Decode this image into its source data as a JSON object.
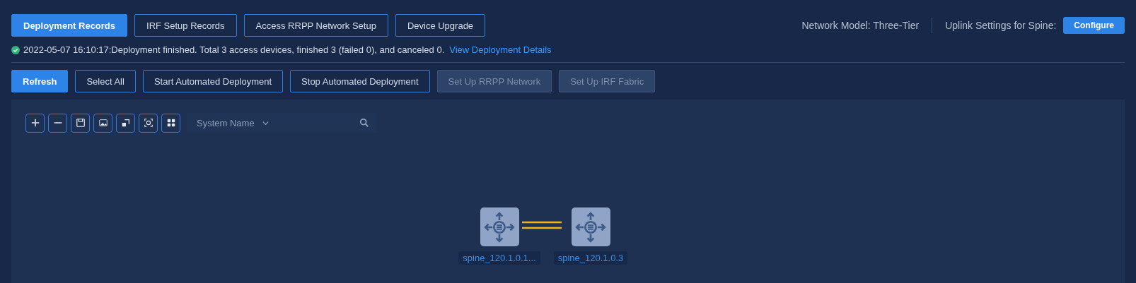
{
  "tabs": [
    {
      "label": "Deployment Records",
      "selected": true
    },
    {
      "label": "IRF Setup Records",
      "selected": false
    },
    {
      "label": "Access RRPP Network Setup",
      "selected": false
    },
    {
      "label": "Device Upgrade",
      "selected": false
    }
  ],
  "network_model": "Network Model: Three-Tier",
  "uplink": {
    "label": "Uplink Settings for Spine:",
    "button": "Configure"
  },
  "status": {
    "message": "2022-05-07 16:10:17:Deployment finished. Total 3 access devices, finished 3 (failed 0), and canceled 0.",
    "link": "View Deployment Details"
  },
  "actions": [
    {
      "label": "Refresh",
      "kind": "primary",
      "disabled": false
    },
    {
      "label": "Select All",
      "kind": "outline",
      "disabled": false
    },
    {
      "label": "Start Automated Deployment",
      "kind": "outline",
      "disabled": false
    },
    {
      "label": "Stop Automated Deployment",
      "kind": "outline",
      "disabled": false
    },
    {
      "label": "Set Up RRPP Network",
      "kind": "outline",
      "disabled": true
    },
    {
      "label": "Set Up IRF Fabric",
      "kind": "outline",
      "disabled": true
    }
  ],
  "search": {
    "filter": "System Name"
  },
  "topology": {
    "nodes": [
      {
        "label": "spine_120.1.0.1..."
      },
      {
        "label": "spine_120.1.0.3"
      }
    ]
  }
}
